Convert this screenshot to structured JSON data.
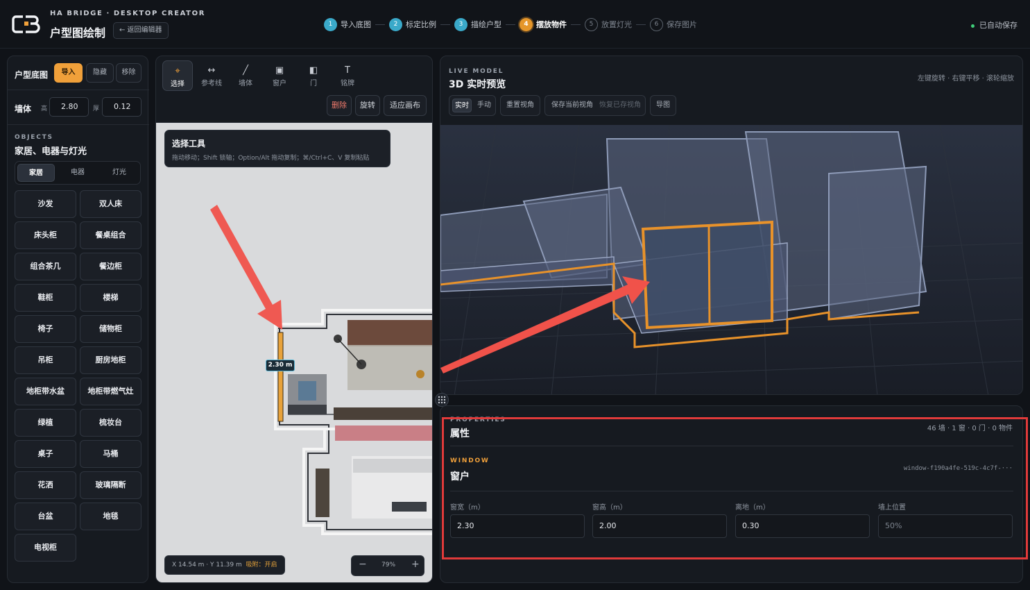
{
  "header": {
    "brand_sub": "HA BRIDGE · DESKTOP CREATOR",
    "title": "户型图绘制",
    "back_label": "← 返回编辑器",
    "autosave": "已自动保存",
    "steps": [
      {
        "num": "1",
        "label": "导入底图",
        "state": "done"
      },
      {
        "num": "2",
        "label": "标定比例",
        "state": "done"
      },
      {
        "num": "3",
        "label": "描绘户型",
        "state": "done"
      },
      {
        "num": "4",
        "label": "摆放物件",
        "state": "active"
      },
      {
        "num": "5",
        "label": "放置灯光",
        "state": "todo"
      },
      {
        "num": "6",
        "label": "保存图片",
        "state": "todo"
      }
    ]
  },
  "left": {
    "floorplan_label": "户型底图",
    "import_label": "导入",
    "hide_label": "隐藏",
    "remove_label": "移除",
    "wall_label": "墙体",
    "height_label": "高",
    "height_value": "2.80",
    "thick_label": "厚",
    "thick_value": "0.12",
    "objects_eyebrow": "OBJECTS",
    "objects_title": "家居、电器与灯光",
    "tabs": [
      "家居",
      "电器",
      "灯光"
    ],
    "items": [
      "沙发",
      "双人床",
      "床头柜",
      "餐桌组合",
      "组合茶几",
      "餐边柜",
      "鞋柜",
      "楼梯",
      "椅子",
      "储物柜",
      "吊柜",
      "厨房地柜",
      "地柜带水盆",
      "地柜带燃气灶",
      "绿植",
      "梳妆台",
      "桌子",
      "马桶",
      "花洒",
      "玻璃隔断",
      "台盆",
      "地毯",
      "电视柜"
    ]
  },
  "toolbar": {
    "tools": [
      {
        "icon": "⌖",
        "label": "选择"
      },
      {
        "icon": "↔",
        "label": "参考线"
      },
      {
        "icon": "╱",
        "label": "墙体"
      },
      {
        "icon": "▣",
        "label": "窗户"
      },
      {
        "icon": "◧",
        "label": "门"
      },
      {
        "icon": "T",
        "label": "铭牌"
      }
    ],
    "delete_label": "删除",
    "rotate_label": "旋转",
    "fit_label": "适应画布"
  },
  "canvas": {
    "tip_title": "选择工具",
    "tip_desc": "拖动移动；Shift 锁轴；Option/Alt 拖动复制；⌘/Ctrl+C、V 复制粘贴",
    "dimension_label": "2.30 m",
    "coords": "X 14.54 m · Y 11.39 m",
    "snap": "吸附：开启",
    "zoom_minus": "−",
    "zoom_value": "79%",
    "zoom_plus": "+"
  },
  "preview": {
    "eyebrow": "LIVE MODEL",
    "title": "3D 实时预览",
    "hint": "左键旋转 · 右键平移 · 滚轮缩放",
    "mode_live": "实时",
    "mode_manual": "手动",
    "reset_view": "重置视角",
    "save_view": "保存当前视角",
    "restore_view": "恢复已存视角",
    "export": "导图"
  },
  "properties": {
    "eyebrow": "PROPERTIES",
    "title": "属性",
    "summary": "46 墙 · 1 窗 · 0 门 · 0 物件",
    "kind_eyebrow": "WINDOW",
    "kind_title": "窗户",
    "object_id": "window-f190a4fe-519c-4c7f-···",
    "fields": [
      {
        "label": "窗宽（m）",
        "value": "2.30"
      },
      {
        "label": "窗高（m）",
        "value": "2.00"
      },
      {
        "label": "离地（m）",
        "value": "0.30"
      },
      {
        "label": "墙上位置",
        "value": "50%"
      }
    ]
  },
  "colors": {
    "accent": "#f0a03a",
    "step_done": "#3aa9c9",
    "highlight": "#e03a3a",
    "arrow": "#f0524a"
  }
}
